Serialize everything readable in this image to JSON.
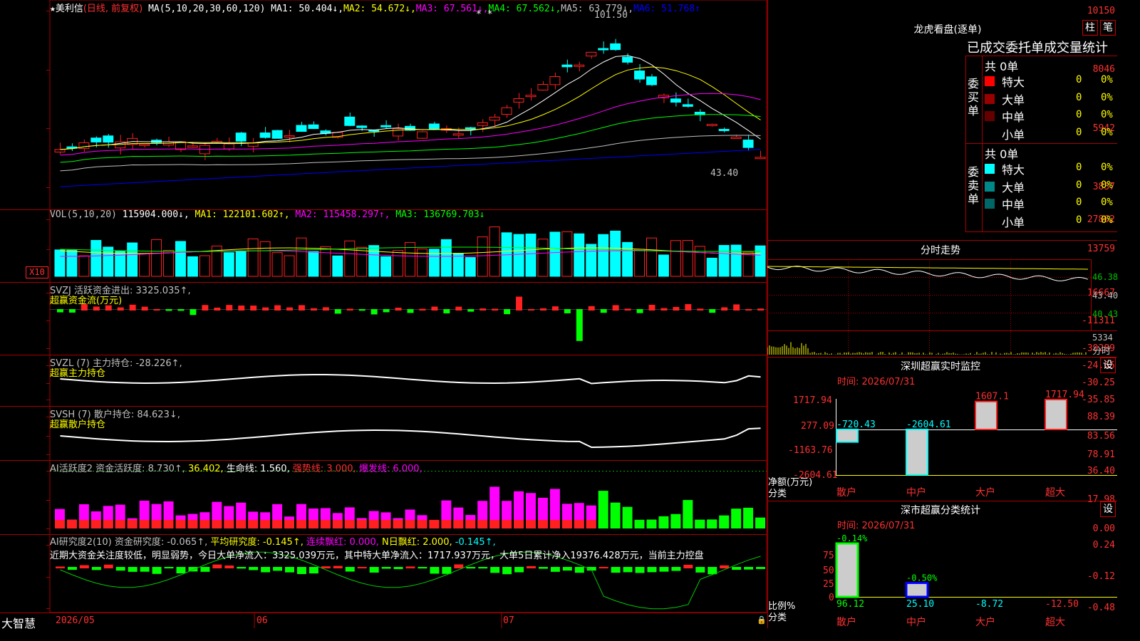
{
  "colors": {
    "up": "#ff2020",
    "down": "#00ffff",
    "grid": "#aa0000",
    "ma1": "#ffffff",
    "ma2": "#ffff00",
    "ma3": "#ff00ff",
    "ma4": "#00ff00",
    "ma5": "#c0c0c0",
    "ma6": "#0000ff"
  },
  "stock": {
    "star": "★",
    "name": "美利信",
    "mode": "(日线, 前复权)",
    "ma_label": "MA(5,10,20,30,60,120)",
    "ma1": "MA1: 50.404↓,",
    "ma2": "MA2: 54.672↓,",
    "ma3": "MA3: 67.561↓,",
    "ma4": "MA4: 67.562↓,",
    "ma5": "MA5: 63.779↓,",
    "ma6": "MA6: 51.768↑",
    "high_mark": "101.50",
    "low_mark": "43.40",
    "stars": "* *",
    "y_labels": [
      "10150",
      "8046",
      "5942",
      "3837"
    ]
  },
  "vol": {
    "label": "VOL(5,10,20)",
    "value": "115904.000↓,",
    "ma1": "MA1: 122101.602↑,",
    "ma2": "MA2: 115458.297↑,",
    "ma3": "MA3: 136769.703↓",
    "y_labels": [
      "27862",
      "13759"
    ],
    "unit": "X10"
  },
  "svzj": {
    "label": "SVZJ  活跃资金进出: 3325.035↑,",
    "sub": "超赢资金流(万元)",
    "y_labels": [
      "16667",
      "-11311",
      "-39289"
    ]
  },
  "svzl": {
    "label": "SVZL (7) 主力持仓: -28.226↑,",
    "sub": "超赢主力持仓",
    "y_labels": [
      "-24.65",
      "-30.25",
      "-35.85"
    ]
  },
  "svsh": {
    "label": "SVSH (7) 散户持仓: 84.623↓,",
    "sub": "超赢散户持仓",
    "y_labels": [
      "88.39",
      "83.56",
      "78.91"
    ]
  },
  "ai_active": {
    "label": "AI活跃度2 资金活跃度: 8.730↑,",
    "v2": "36.402,",
    "v3": "生命线: 1.560,",
    "v4": "强势线: 3.000,",
    "v5": "爆发线: 6.000,",
    "y_labels": [
      "36.40",
      "17.98",
      "0.00"
    ]
  },
  "ai_research": {
    "label": "AI研究度2(10) 资金研究度: -0.065↑,",
    "v2": "平均研究度: -0.145↑,",
    "v3": "连续飘红: 0.000,",
    "v4": "N日飘红: 2.000,",
    "v5": "-0.145↑,",
    "comment": "近期大资金关注度较低，明显弱势，今日大单净流入：3325.039万元，其中特大单净流入：1717.937万元，大单5日累计净入19376.428万元，当前主力控盘",
    "y_labels": [
      "0.24",
      "-0.12",
      "-0.48"
    ]
  },
  "footer": {
    "brand": "大智慧",
    "dates": [
      "2026/05",
      "06",
      "07"
    ]
  },
  "right": {
    "dragon_title": "龙虎看盘(逐单)",
    "btn_zhu": "柱",
    "btn_bi": "笔",
    "tabs": "已成交委托单成交量统计",
    "buy_label": "委买单",
    "sell_label": "委卖单",
    "buy_total": "共 0单",
    "sell_total": "共 0单",
    "buy_rows": [
      {
        "name": "特大",
        "count": "0",
        "pct": "0%"
      },
      {
        "name": "大单",
        "count": "0",
        "pct": "0%"
      },
      {
        "name": "中单",
        "count": "0",
        "pct": "0%"
      },
      {
        "name": "小单",
        "count": "0",
        "pct": "0%"
      }
    ],
    "sell_rows": [
      {
        "name": "特大",
        "count": "0",
        "pct": "0%"
      },
      {
        "name": "大单",
        "count": "0",
        "pct": "0%"
      },
      {
        "name": "中单",
        "count": "0",
        "pct": "0%"
      },
      {
        "name": "小单",
        "count": "0",
        "pct": "0%"
      }
    ],
    "intraday_title": "分时走势",
    "intraday_prices": [
      "46.38",
      "43.40",
      "40.43"
    ],
    "intraday_vol": "5334",
    "intraday_unit": "分时",
    "monitor_title": "深圳超赢实时监控",
    "monitor_btn": "设",
    "monitor_time": "时间: 2026/07/31",
    "monitor_y": [
      "1717.94",
      "277.09",
      "-1163.76",
      "-2604.61"
    ],
    "monitor_unit1": "净额(万元)",
    "monitor_unit2": "分类",
    "monitor_bars": [
      {
        "cat": "散户",
        "label": "-720.43",
        "value": -720.43
      },
      {
        "cat": "中户",
        "label": "-2604.61",
        "value": -2604.61
      },
      {
        "cat": "大户",
        "label": "1607.1",
        "value": 1607.1
      },
      {
        "cat": "超大",
        "label": "1717.94",
        "value": 1717.94
      }
    ],
    "class_title": "深市超赢分类统计",
    "class_btn": "设",
    "class_time": "时间: 2026/07/31",
    "class_y": [
      "75",
      "50",
      "25",
      "0"
    ],
    "class_unit1": "比例%",
    "class_unit2": "分类",
    "class_bars": [
      {
        "cat": "散户",
        "top": "-0.14%",
        "bottom": "96.12",
        "value": 96.12
      },
      {
        "cat": "中户",
        "top": "-0.50%",
        "bottom": "25.10",
        "value": 25.1
      },
      {
        "cat": "大户",
        "top": "",
        "bottom": "-8.72",
        "value": 0
      },
      {
        "cat": "超大",
        "top": "",
        "bottom": "-12.50",
        "value": 0
      }
    ]
  }
}
